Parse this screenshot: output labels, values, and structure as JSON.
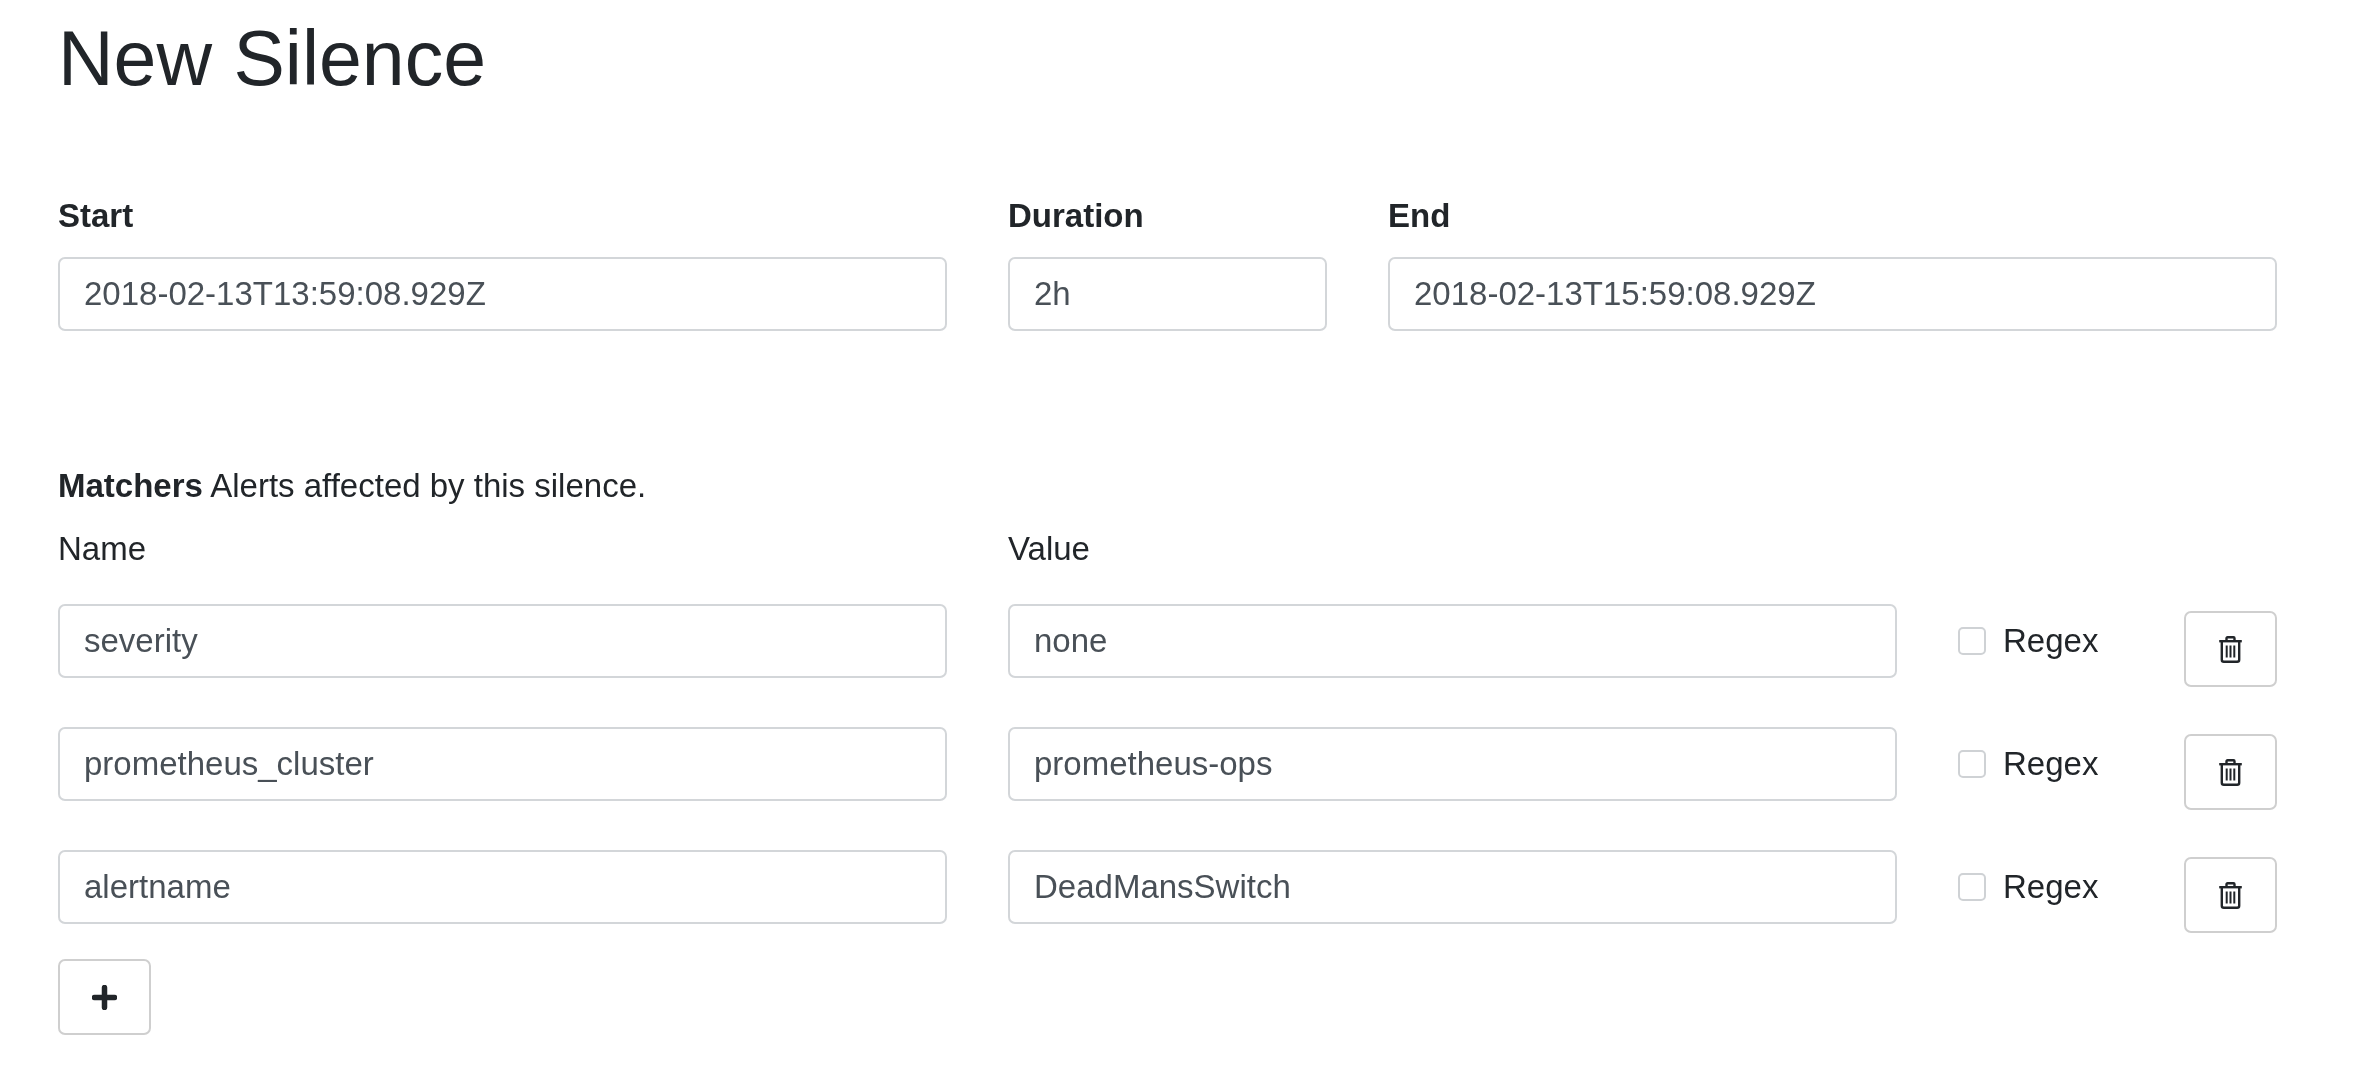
{
  "title": "New Silence",
  "time_fields": [
    {
      "kind": "wide",
      "label": "Start",
      "value": "2018-02-13T13:59:08.929Z"
    },
    {
      "kind": "narrow",
      "label": "Duration",
      "value": "2h"
    },
    {
      "kind": "wide",
      "label": "End",
      "value": "2018-02-13T15:59:08.929Z"
    }
  ],
  "matchers": {
    "heading": "**Matchers** Alerts affected by this silence.",
    "name_label": "Name",
    "value_label": "Value",
    "rows": [
      {
        "name": "severity",
        "value": "none",
        "regex_label": "Regex",
        "regex": false
      },
      {
        "name": "prometheus_cluster",
        "value": "prometheus-ops",
        "regex_label": "Regex",
        "regex": false
      },
      {
        "name": "alertname",
        "value": "DeadMansSwitch",
        "regex_label": "Regex",
        "regex": false
      }
    ]
  }
}
